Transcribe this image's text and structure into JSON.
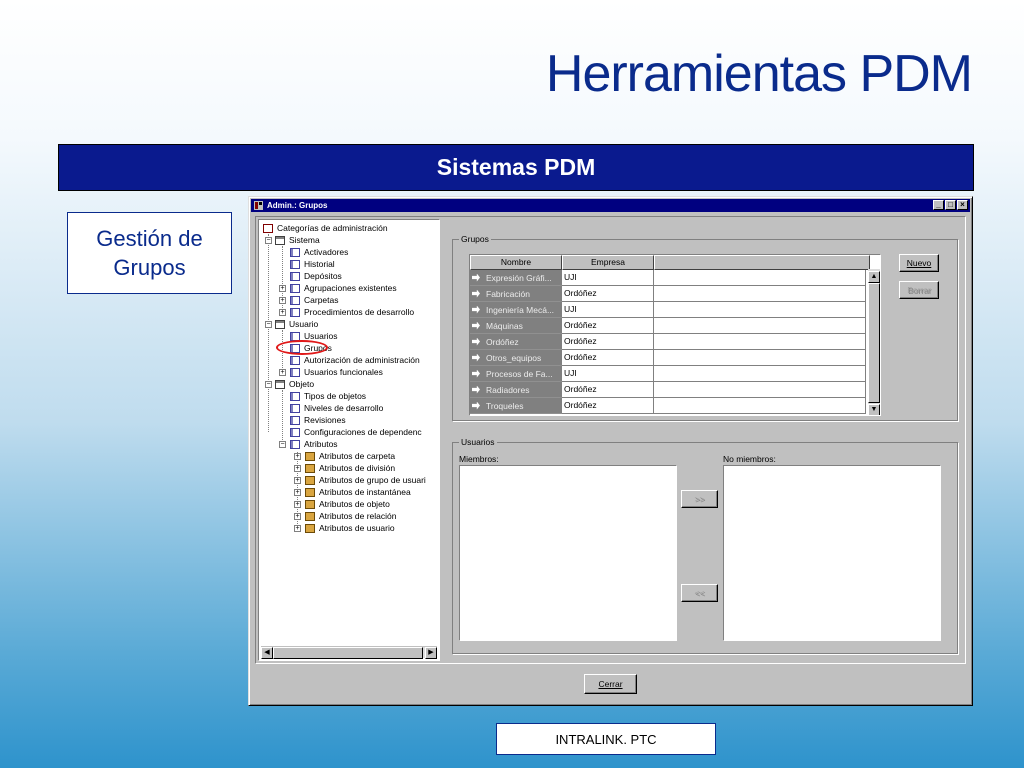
{
  "slide": {
    "title": "Herramientas PDM",
    "banner": "Sistemas PDM",
    "callout": "Gestión de Grupos",
    "footer": "INTRALINK. PTC"
  },
  "window": {
    "title": "Admin.: Grupos",
    "controls": {
      "minimize": "_",
      "maximize": "□",
      "close": "×"
    }
  },
  "tree": {
    "items": [
      {
        "label": "Categorías de administración",
        "icon": "root-icon"
      },
      {
        "label": "Sistema",
        "icon": "open-folder-icon"
      },
      {
        "label": "Activadores",
        "icon": "node-icon"
      },
      {
        "label": "Historial",
        "icon": "node-icon"
      },
      {
        "label": "Depósitos",
        "icon": "node-icon"
      },
      {
        "label": "Agrupaciones existentes",
        "icon": "node-icon"
      },
      {
        "label": "Carpetas",
        "icon": "node-icon"
      },
      {
        "label": "Procedimientos de desarrollo",
        "icon": "node-icon"
      },
      {
        "label": "Usuario",
        "icon": "open-folder-icon"
      },
      {
        "label": "Usuarios",
        "icon": "node-icon"
      },
      {
        "label": "Grupos",
        "icon": "node-icon"
      },
      {
        "label": "Autorización de administración",
        "icon": "node-icon"
      },
      {
        "label": "Usuarios funcionales",
        "icon": "node-icon"
      },
      {
        "label": "Objeto",
        "icon": "open-folder-icon"
      },
      {
        "label": "Tipos de objetos",
        "icon": "node-icon"
      },
      {
        "label": "Niveles de desarrollo",
        "icon": "node-icon"
      },
      {
        "label": "Revisiones",
        "icon": "node-icon"
      },
      {
        "label": "Configuraciones de dependenc",
        "icon": "node-icon"
      },
      {
        "label": "Atributos",
        "icon": "node-icon"
      },
      {
        "label": "Atributos de carpeta",
        "icon": "folder-icon"
      },
      {
        "label": "Atributos de división",
        "icon": "folder-icon"
      },
      {
        "label": "Atributos de grupo de usuari",
        "icon": "folder-icon"
      },
      {
        "label": "Atributos de instantánea",
        "icon": "folder-icon"
      },
      {
        "label": "Atributos de objeto",
        "icon": "folder-icon"
      },
      {
        "label": "Atributos de relación",
        "icon": "folder-icon"
      },
      {
        "label": "Atributos de usuario",
        "icon": "folder-icon"
      }
    ]
  },
  "groups": {
    "legend": "Grupos",
    "columns": [
      "Nombre",
      "Empresa"
    ],
    "rows": [
      {
        "name": "Expresión Gráfi...",
        "company": "UJI"
      },
      {
        "name": "Fabricación",
        "company": "Ordóñez"
      },
      {
        "name": "Ingeniería Mecá...",
        "company": "UJI"
      },
      {
        "name": "Máquinas",
        "company": "Ordóñez"
      },
      {
        "name": "Ordóñez",
        "company": "Ordóñez"
      },
      {
        "name": "Otros_equipos",
        "company": "Ordóñez"
      },
      {
        "name": "Procesos de Fa...",
        "company": "UJI"
      },
      {
        "name": "Radiadores",
        "company": "Ordóñez"
      },
      {
        "name": "Troqueles",
        "company": "Ordóñez"
      }
    ],
    "new_button": "Nuevo",
    "delete_button": "Borrar"
  },
  "users": {
    "legend": "Usuarios",
    "members_label": "Miembros:",
    "non_members_label": "No miembros:",
    "add_button": ">>",
    "remove_button": "<<"
  },
  "close_button": "Cerrar",
  "colors": {
    "slide_title": "#0a2b8c",
    "banner": "#0a1a8e",
    "titlebar": "#000080",
    "highlight": "#e01818"
  }
}
